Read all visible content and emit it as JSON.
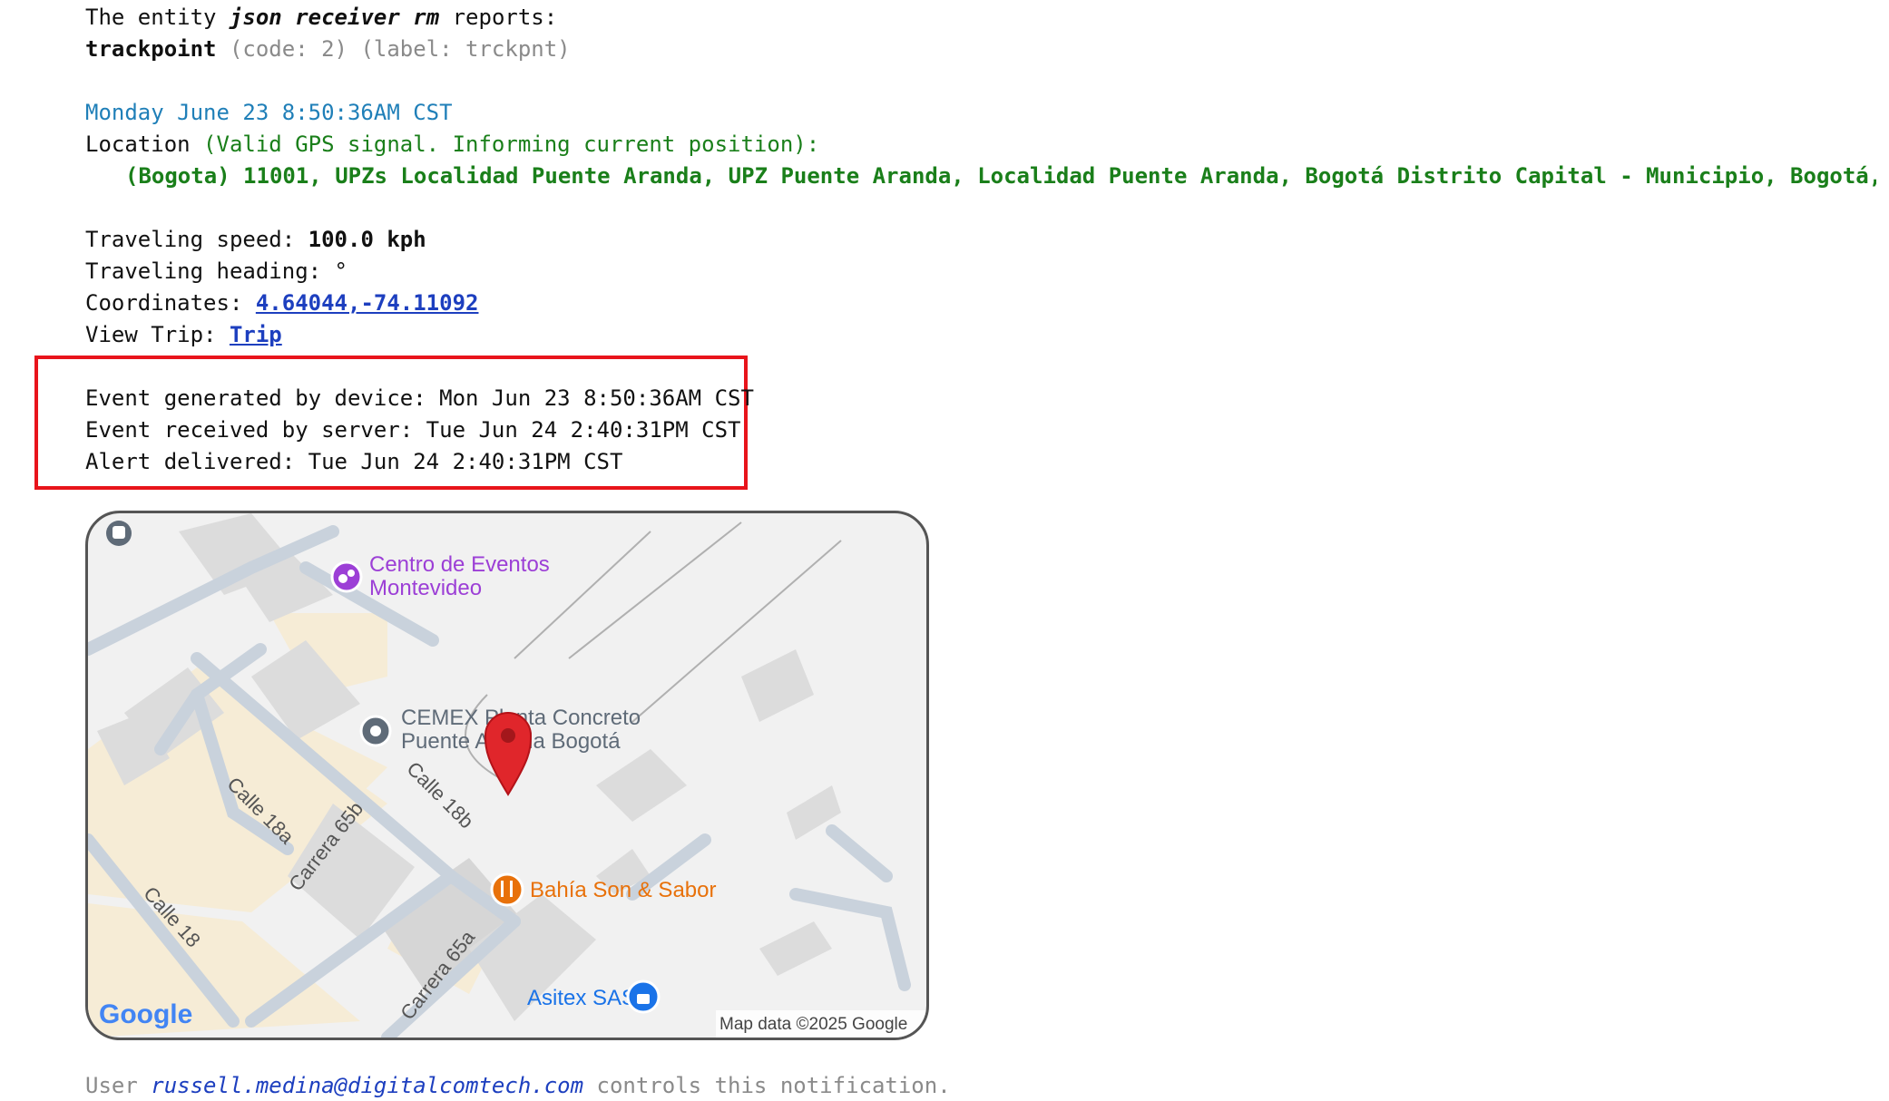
{
  "header": {
    "prefix": "The entity ",
    "entity_name": "json receiver rm",
    "suffix": " reports:",
    "event_type": "trackpoint",
    "event_meta": " (code: 2) (label: trckpnt)"
  },
  "event": {
    "date_line": "Monday June 23 8:50:36AM CST",
    "location_label": "Location ",
    "location_status": "(Valid GPS signal. Informing current position):",
    "address": "(Bogota) 11001, UPZs Localidad Puente Aranda, UPZ Puente Aranda, Localidad Puente Aranda, Bogotá Distrito Capital - Municipio, Bogotá, CO",
    "speed_label": "Traveling speed: ",
    "speed_value": "100.0 kph",
    "heading_label": "Traveling heading: °",
    "coords_label": "Coordinates: ",
    "coords_value": "4.64044,-74.11092",
    "trip_label": "View Trip: ",
    "trip_link": "Trip"
  },
  "timestamps": {
    "generated": "Event generated by device: Mon Jun 23 8:50:36AM CST",
    "received": "Event received by server: Tue Jun 24 2:40:31PM CST",
    "delivered": "Alert delivered: Tue Jun 24 2:40:31PM CST"
  },
  "map": {
    "places": {
      "events_center_1": "Centro de Eventos",
      "events_center_2": "Montevideo",
      "cemex_1": "CEMEX Planta Concreto",
      "cemex_2": "Puente Aranda Bogotá",
      "restaurant": "Bahía Son & Sabor",
      "asitex": "Asitex SAS"
    },
    "streets": {
      "calle_18a": "Calle 18a",
      "carrera_65b": "Carrera 65b",
      "calle_18b": "Calle 18b",
      "calle_18": "Calle 18",
      "carrera_65a": "Carrera 65a"
    },
    "google_logo": "Google",
    "attribution": "Map data ©2025 Google",
    "icons": {
      "pin": "red-location-pin-icon",
      "events": "events-venue-icon",
      "cemex": "place-marker-icon",
      "restaurant": "restaurant-icon",
      "asitex": "shopping-icon",
      "transit": "bus-icon"
    },
    "colors": {
      "pin": "#e0262b",
      "events": "#9c3fd6",
      "restaurant": "#e8710a",
      "asitex": "#1a73e8"
    }
  },
  "footer": {
    "prefix": "User ",
    "email": "russell.medina@digitalcomtech.com",
    "suffix": " controls this notification."
  }
}
